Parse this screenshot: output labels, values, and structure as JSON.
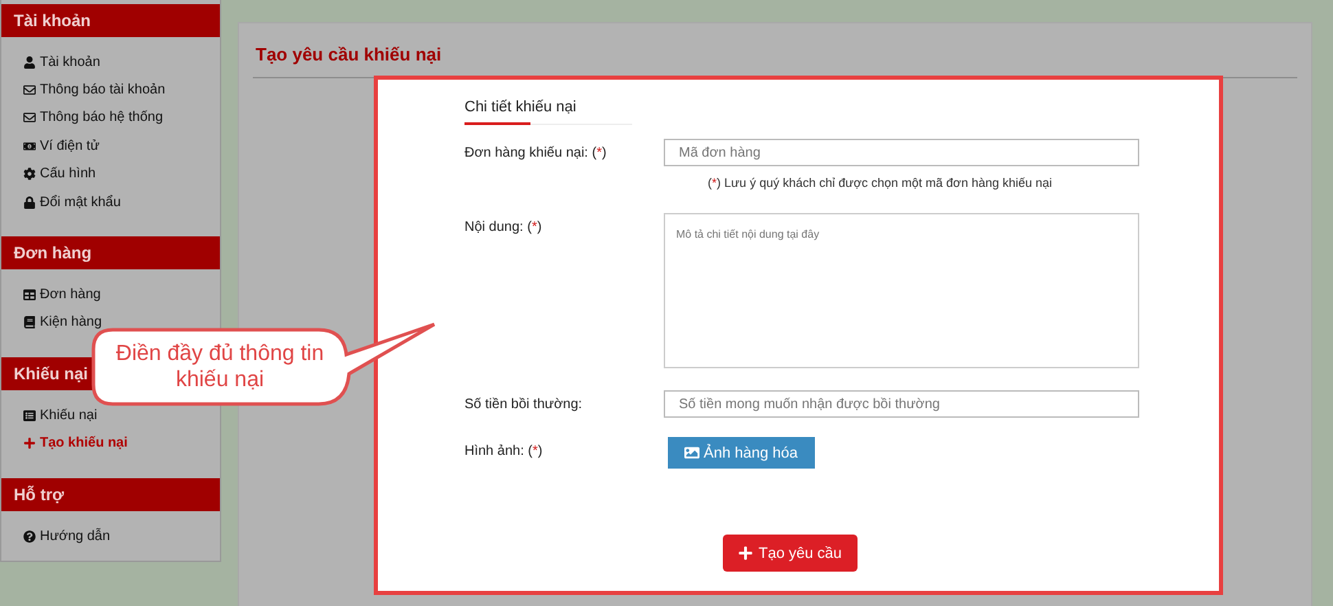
{
  "sidebar": {
    "sections": [
      {
        "title": "Tài khoản",
        "items": [
          {
            "label": "Tài khoản",
            "selected": false
          },
          {
            "label": "Thông báo tài khoản",
            "selected": false
          },
          {
            "label": "Thông báo hệ thống",
            "selected": false
          },
          {
            "label": "Ví điện tử",
            "selected": false
          },
          {
            "label": "Cấu hình",
            "selected": false
          },
          {
            "label": "Đổi mật khẩu",
            "selected": false
          }
        ]
      },
      {
        "title": "Đơn hàng",
        "items": [
          {
            "label": "Đơn hàng",
            "selected": false
          },
          {
            "label": "Kiện hàng",
            "selected": false
          }
        ]
      },
      {
        "title": "Khiếu nại",
        "items": [
          {
            "label": "Khiếu nại",
            "selected": false
          },
          {
            "label": "Tạo khiếu nại",
            "selected": true
          }
        ]
      },
      {
        "title": "Hỗ trợ",
        "items": [
          {
            "label": "Hướng dẫn",
            "selected": false
          }
        ]
      }
    ]
  },
  "page_title": "Tạo yêu cầu khiếu nại",
  "form": {
    "section_title": "Chi tiết khiếu nại",
    "fields": [
      {
        "kind": "input",
        "label": "Đơn hàng khiếu nại:",
        "required_mark": "(*)",
        "placeholder": "Mã đơn hàng",
        "note_mark": "(*)",
        "note": "Lưu ý quý khách chỉ được chọn một mã đơn hàng khiếu nại"
      },
      {
        "kind": "textarea",
        "label": "Nội dung:",
        "required_mark": "(*)",
        "placeholder": "Mô tả chi tiết nội dung tại đây"
      },
      {
        "kind": "input",
        "label": "Số tiền bồi thường:",
        "placeholder": "Số tiền mong muốn nhận được bồi thường"
      },
      {
        "kind": "upload",
        "label": "Hình ảnh:",
        "required_mark": "(*)",
        "button": "Ảnh hàng hóa"
      }
    ],
    "submit": "Tạo yêu cầu"
  },
  "callout": {
    "text": "Điền đầy đủ thông tin khiếu nại"
  }
}
